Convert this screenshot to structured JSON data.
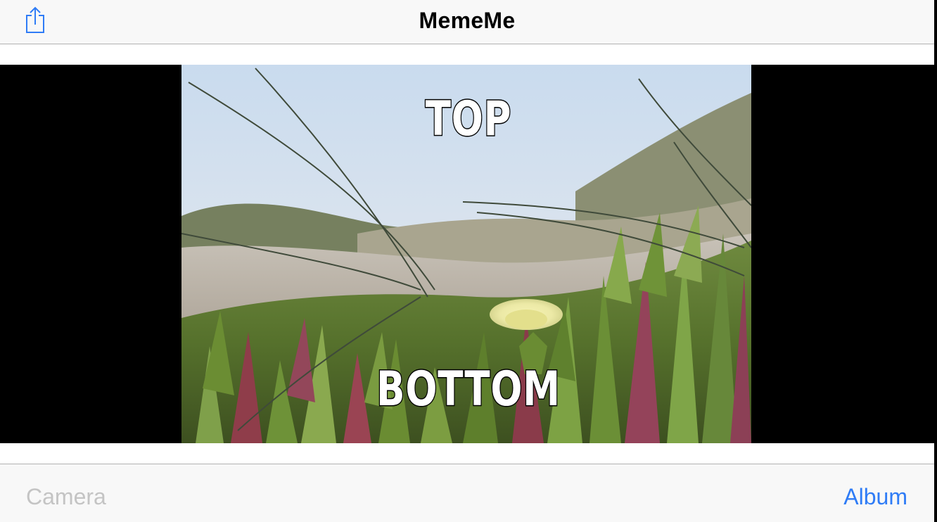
{
  "navbar": {
    "title": "MemeMe",
    "share_icon": "share-icon"
  },
  "meme": {
    "top_text": "TOP",
    "bottom_text": "BOTTOM"
  },
  "toolbar": {
    "camera_label": "Camera",
    "album_label": "Album"
  },
  "colors": {
    "accent": "#2f7cf6",
    "disabled": "#c4c4c4",
    "bar_background": "#f8f8f8",
    "letterbox": "#000000"
  }
}
